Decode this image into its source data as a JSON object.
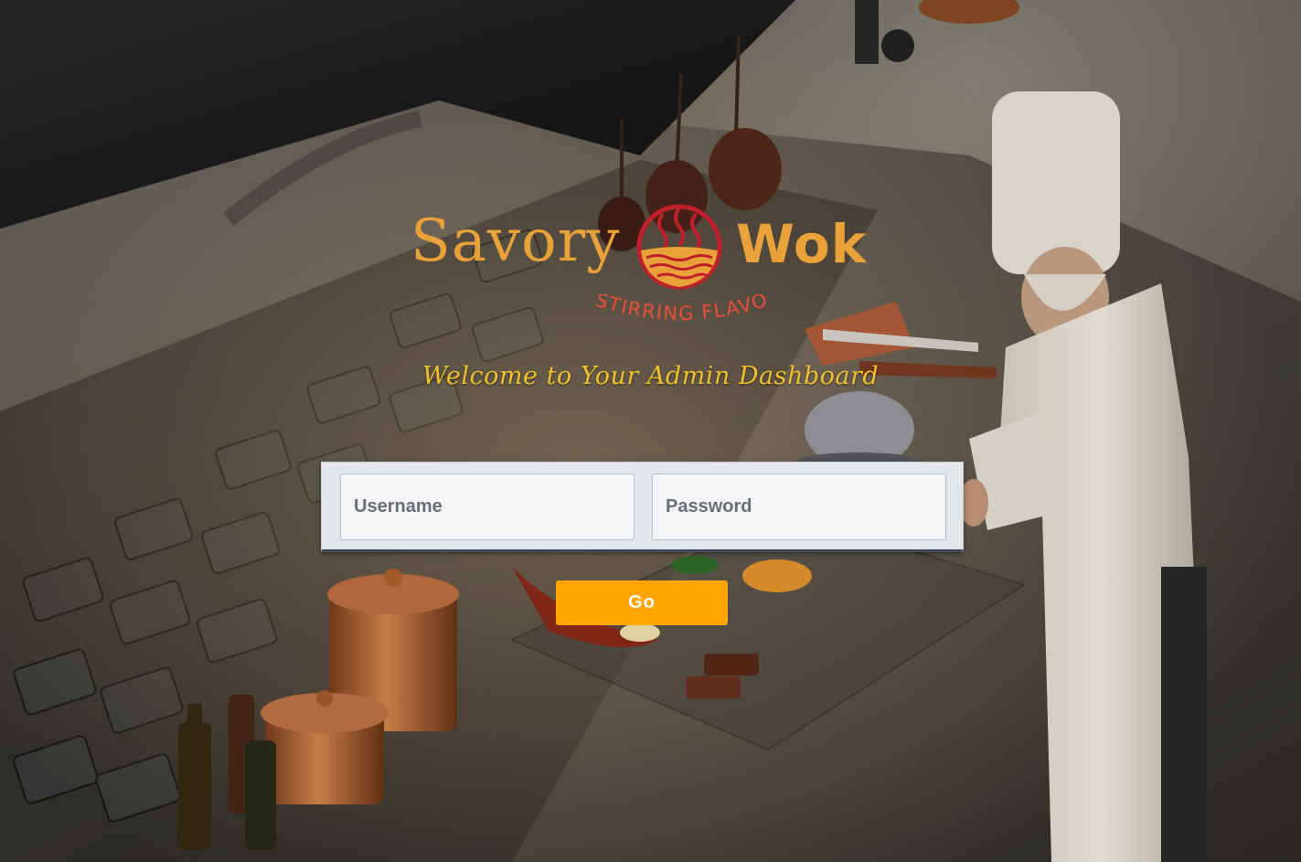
{
  "brand": {
    "name_part1": "Savory",
    "name_part2": "Wok",
    "tagline": "STIRRING FLAVORS",
    "colors": {
      "logo_gold": "#e9a23a",
      "logo_red": "#c0202a",
      "tagline_red": "#e8503a"
    }
  },
  "welcome_text": "Welcome to Your Admin Dashboard",
  "login_form": {
    "username_placeholder": "Username",
    "password_placeholder": "Password",
    "submit_label": "Go"
  },
  "colors": {
    "button": "#ffa500",
    "welcome": "#f2c22e",
    "panel": "#e3e6ea"
  }
}
